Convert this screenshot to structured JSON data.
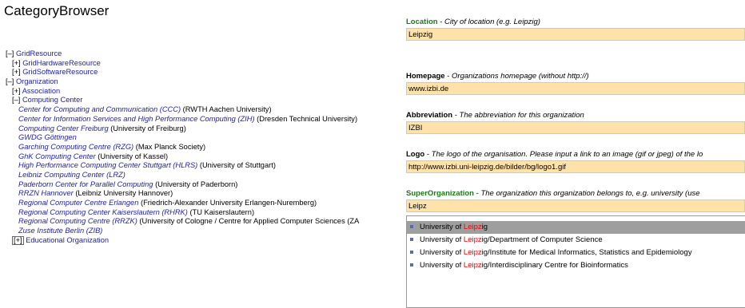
{
  "app_title": "CategoryBrowser",
  "tree": {
    "grid_resource": {
      "toggle": "[–]",
      "label": "GridResource"
    },
    "grid_hardware": {
      "toggle": "[+]",
      "label": "GridHardwareResource"
    },
    "grid_software": {
      "toggle": "[+]",
      "label": "GridSoftwareResource"
    },
    "organization": {
      "toggle": "[–]",
      "label": "Organization"
    },
    "association": {
      "toggle": "[+]",
      "label": "Association"
    },
    "computing_center": {
      "toggle": "[–]",
      "label": "Computing Center"
    },
    "centers": [
      {
        "name": "Center for Computing and Communication (CCC)",
        "org": "(RWTH Aachen University)"
      },
      {
        "name": "Center for Information Services and High Performance Computing (ZIH)",
        "org": "(Dresden Technical University)"
      },
      {
        "name": "Computing Center Freiburg",
        "org": "(University of Freiburg)"
      },
      {
        "name": "GWDG Göttingen",
        "org": ""
      },
      {
        "name": "Garching Computing Centre (RZG)",
        "org": "(Max Planck Society)"
      },
      {
        "name": "GhK Computing Center",
        "org": "(University of Kassel)"
      },
      {
        "name": "High Performance Computing Center Stuttgart (HLRS)",
        "org": "(University of Stuttgart)"
      },
      {
        "name": "Leibniz Computing Center (LRZ)",
        "org": ""
      },
      {
        "name": "Paderborn Center for Parallel Computing",
        "org": "(University of Paderborn)"
      },
      {
        "name": "RRZN Hannover",
        "org": "(Leibniz University Hannover)"
      },
      {
        "name": "Regional Computer Centre Erlangen",
        "org": "(Friedrich-Alexander University Erlangen-Nuremberg)"
      },
      {
        "name": "Regional Computing Center Kaiserslautern (RHRK)",
        "org": "(TU Kaiserslautern)"
      },
      {
        "name": "Regional Computing Centre (RRZK)",
        "org": "(University of Cologne / Centre for Applied Computer Sciences (ZA"
      },
      {
        "name": "Zuse Institute Berlin (ZIB)",
        "org": ""
      }
    ],
    "educational": {
      "toggle": "[+]",
      "label": "Educational Organization"
    }
  },
  "form": {
    "location": {
      "name": "Location",
      "sep": " - ",
      "desc": "City of location (e.g. Leipzig)",
      "value": "Leipzig"
    },
    "homepage": {
      "name": "Homepage",
      "sep": " - ",
      "desc": "Organizations homepage (without http://)",
      "value": "www.izbi.de"
    },
    "abbreviation": {
      "name": "Abbreviation",
      "sep": " - ",
      "desc": "The abbreviation for this organization",
      "value": "IZBI"
    },
    "logo": {
      "name": "Logo",
      "sep": " - ",
      "desc": "The logo of the organisation. Please input a link to an image (gif or jpeg) of the lo",
      "value": "http://www.izbi.uni-leipzig.de/bilder/bg/logo1.gif"
    },
    "superorg": {
      "name": "SuperOrganization",
      "sep": " - ",
      "desc": "The organization this organization belongs to, e.g. university (use",
      "value": "Leipz"
    }
  },
  "suggestions": [
    {
      "pre": "University of ",
      "match": "Leipz",
      "post": "ig",
      "selected": true
    },
    {
      "pre": "University of ",
      "match": "Leipz",
      "post": "ig/Department of Computer Science",
      "selected": false
    },
    {
      "pre": "University of ",
      "match": "Leipz",
      "post": "ig/Institute for Medical Informatics, Statistics and Epidemiology",
      "selected": false
    },
    {
      "pre": "University of ",
      "match": "Leipz",
      "post": "ig/Interdisciplinary Centre for Bioinformatics",
      "selected": false
    }
  ],
  "colors": {
    "field_bg": "#ffe1aa",
    "selected_bg": "#9e9e9e",
    "highlight": "#e00000",
    "link": "#2222aa",
    "green_label": "#1a7a1a"
  }
}
